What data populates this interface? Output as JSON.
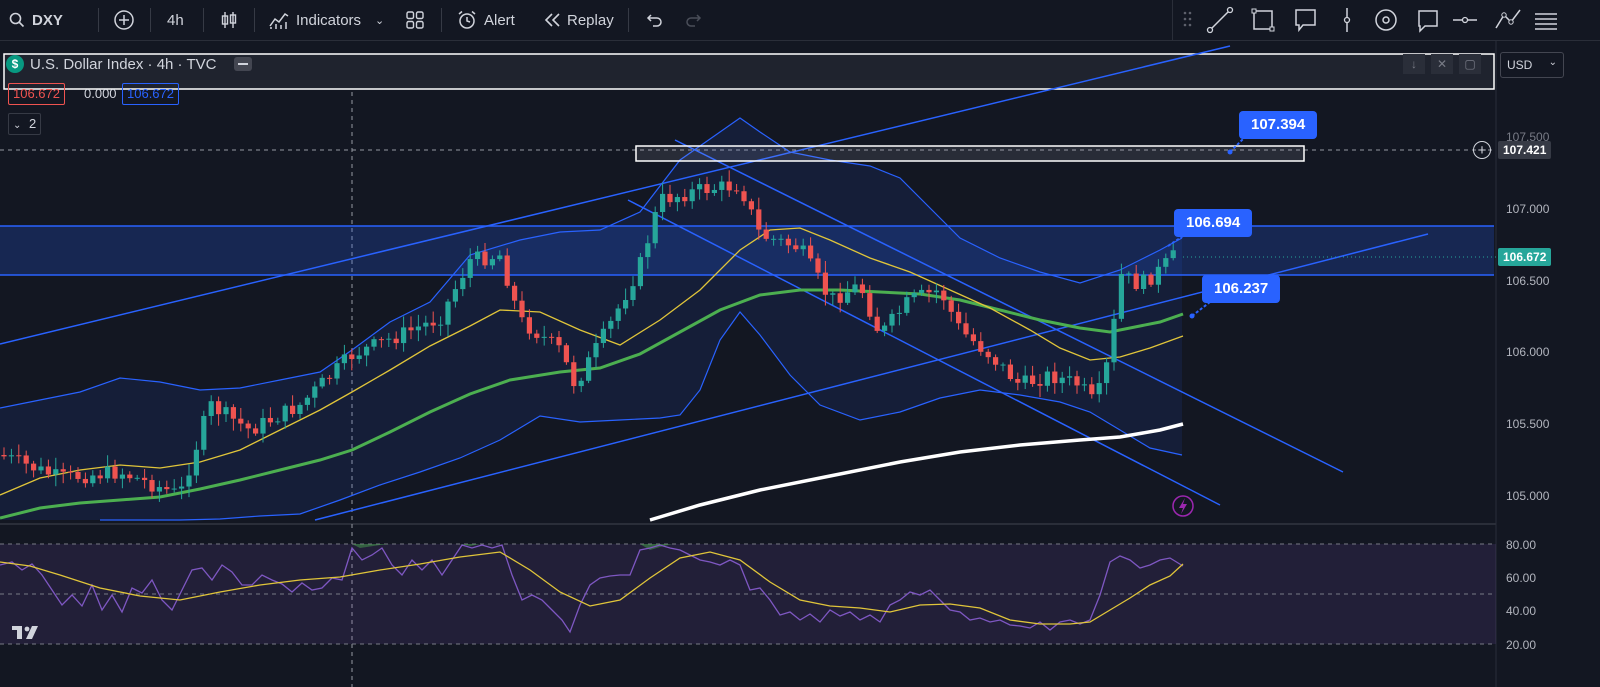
{
  "toolbar": {
    "symbol": "DXY",
    "interval": "4h",
    "indicators_label": "Indicators",
    "alert_label": "Alert",
    "replay_label": "Replay"
  },
  "legend": {
    "title": "U.S. Dollar Index · 4h · TVC",
    "bid": "106.672",
    "spread": "0.000",
    "ask": "106.672",
    "collapse_count": "2"
  },
  "price_axis": {
    "currency": "USD",
    "ticks": [
      "107.500",
      "107.000",
      "106.500",
      "106.000",
      "105.500",
      "105.000"
    ],
    "crosshair_price": "107.421",
    "last_price": "106.672"
  },
  "rsi_axis": {
    "ticks": [
      "80.00",
      "60.00",
      "40.00",
      "20.00"
    ]
  },
  "annotations": {
    "top_callout": "107.394",
    "mid_callout": "106.694",
    "low_callout": "106.237"
  },
  "colors": {
    "background": "#131722",
    "up_candle": "#26a69a",
    "down_candle": "#ef5350",
    "accent_blue": "#2962ff",
    "ma_fast": "#e0c53a",
    "ma_mid": "#4caf50",
    "ma_slow": "#ffffff",
    "rsi_line": "#7e57c2"
  },
  "icons": {
    "search": "search-icon",
    "add": "plus-circle-icon",
    "candles": "candlestick-icon",
    "indicators": "chart-indicators-icon",
    "layout": "grid-layout-icon",
    "alert": "alarm-clock-icon",
    "replay": "rewind-icon",
    "undo": "undo-icon",
    "redo": "redo-icon",
    "logo": "tradingview-logo-icon"
  }
}
